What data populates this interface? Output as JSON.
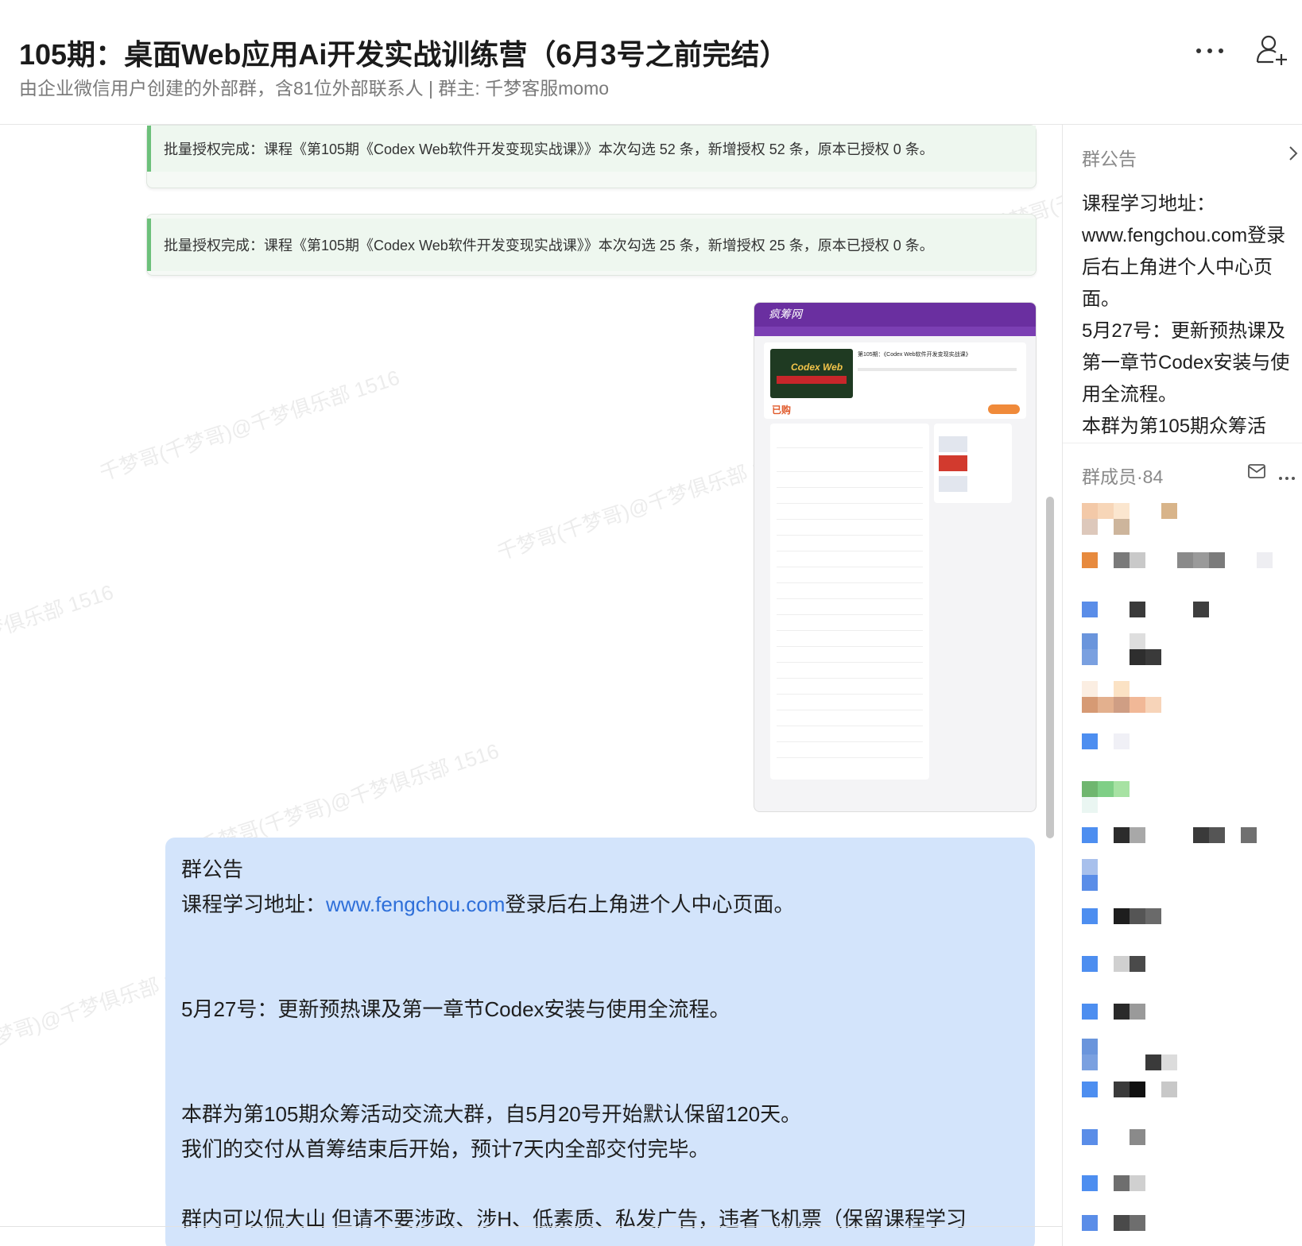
{
  "header": {
    "title": "105期：桌面Web应用Ai开发实战训练营（6月3号之前完结）",
    "subtitle": "由企业微信用户创建的外部群，含81位外部联系人 | 群主: 千梦客服momo",
    "more_icon": "more-dots-icon",
    "add_member_icon": "add-user-icon"
  },
  "watermark_text": "千梦哥(千梦哥)@千梦俱乐部 1516",
  "messages": {
    "system_1": "批量授权完成：课程《第105期《Codex Web软件开发变现实战课》》本次勾选 52 条，新增授权 52 条，原本已授权 0 条。",
    "system_2": "批量授权完成：课程《第105期《Codex Web软件开发变现实战课》》本次勾选 25 条，新增授权 25 条，原本已授权 0 条。",
    "screenshot": {
      "site_logo": "疯筹网",
      "course_title": "第105期：《Codex Web软件开发变现实战课》",
      "banner_text": "Codex Web",
      "purchased": "已购"
    },
    "notice": {
      "heading": "群公告",
      "line1_prefix": "课程学习地址：",
      "line1_link": "www.fengchou.com",
      "line1_suffix": "登录后右上角进个人中心页面。",
      "line2": "5月27号：更新预热课及第一章节Codex安装与使用全流程。",
      "line3": "本群为第105期众筹活动交流大群，自5月20号开始默认保留120天。",
      "line4": "我们的交付从首筹结束后开始，预计7天内全部交付完毕。",
      "line5": "群内可以侃大山 但请不要涉政、涉H、低素质、私发广告，违者飞机票（保留课程学习"
    }
  },
  "panel": {
    "announcement_label": "群公告",
    "announcement_text": [
      "课程学习地址：",
      "www.fengchou.com登录后右上角进个人中心页面。",
      "5月27号：更新预热课及第一章节Codex安装与使用全流程。",
      "本群为第105期众筹活"
    ],
    "members_label": "群成员",
    "members_count": "·84",
    "mail_icon": "mail-icon",
    "more_icon": "more-dots-icon"
  },
  "colors": {
    "notice_bg": "#d3e4fb",
    "link": "#2e6fd9",
    "system_accent": "#6cc07a",
    "site_purple": "#6a2fa0"
  }
}
